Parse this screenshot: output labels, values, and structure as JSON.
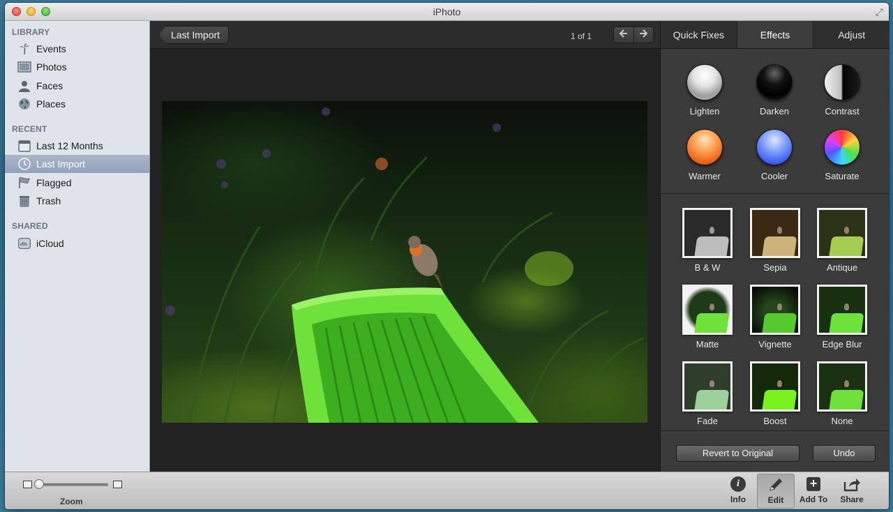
{
  "window": {
    "title": "iPhoto"
  },
  "sidebar": {
    "library_header": "LIBRARY",
    "library_items": [
      {
        "label": "Events",
        "icon": "palm-tree-icon"
      },
      {
        "label": "Photos",
        "icon": "photo-icon"
      },
      {
        "label": "Faces",
        "icon": "person-icon"
      },
      {
        "label": "Places",
        "icon": "globe-icon"
      }
    ],
    "recent_header": "RECENT",
    "recent_items": [
      {
        "label": "Last 12 Months",
        "icon": "calendar-icon"
      },
      {
        "label": "Last Import",
        "icon": "clock-icon",
        "selected": true
      },
      {
        "label": "Flagged",
        "icon": "flag-icon"
      },
      {
        "label": "Trash",
        "icon": "trash-icon"
      }
    ],
    "shared_header": "SHARED",
    "shared_items": [
      {
        "label": "iCloud",
        "icon": "cloud-icon"
      }
    ]
  },
  "main": {
    "back_label": "Last Import",
    "counter": "1 of 1"
  },
  "panel": {
    "tabs": [
      "Quick Fixes",
      "Effects",
      "Adjust"
    ],
    "active_tab": "Effects",
    "quick_fixes": [
      "Lighten",
      "Darken",
      "Contrast",
      "Warmer",
      "Cooler",
      "Saturate"
    ],
    "effects": [
      "B & W",
      "Sepia",
      "Antique",
      "Matte",
      "Vignette",
      "Edge Blur",
      "Fade",
      "Boost",
      "None"
    ],
    "revert_label": "Revert to Original",
    "undo_label": "Undo"
  },
  "bottombar": {
    "zoom_label": "Zoom",
    "zoom_level": 0.0,
    "info_label": "Info",
    "edit_label": "Edit",
    "addto_label": "Add To",
    "share_label": "Share"
  },
  "colors": {
    "accent_selection": "#9aa8be",
    "chair_green": "#6ee23a"
  }
}
